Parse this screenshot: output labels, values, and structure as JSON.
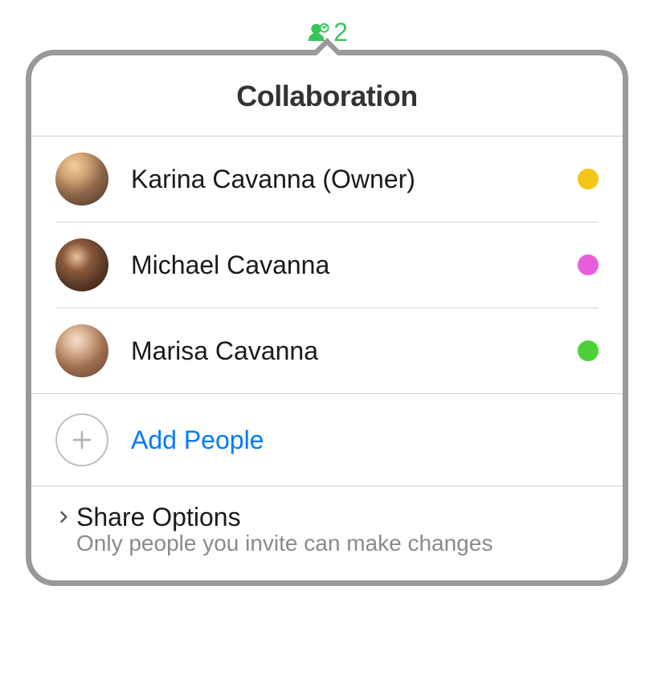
{
  "trigger": {
    "count": "2"
  },
  "header": {
    "title": "Collaboration"
  },
  "participants": [
    {
      "name": "Karina Cavanna (Owner)",
      "statusColor": "#f5c518"
    },
    {
      "name": "Michael Cavanna",
      "statusColor": "#e85dd8"
    },
    {
      "name": "Marisa Cavanna",
      "statusColor": "#4cd137"
    }
  ],
  "addPeople": {
    "label": "Add People"
  },
  "shareOptions": {
    "title": "Share Options",
    "subtitle": "Only people you invite can make changes"
  }
}
